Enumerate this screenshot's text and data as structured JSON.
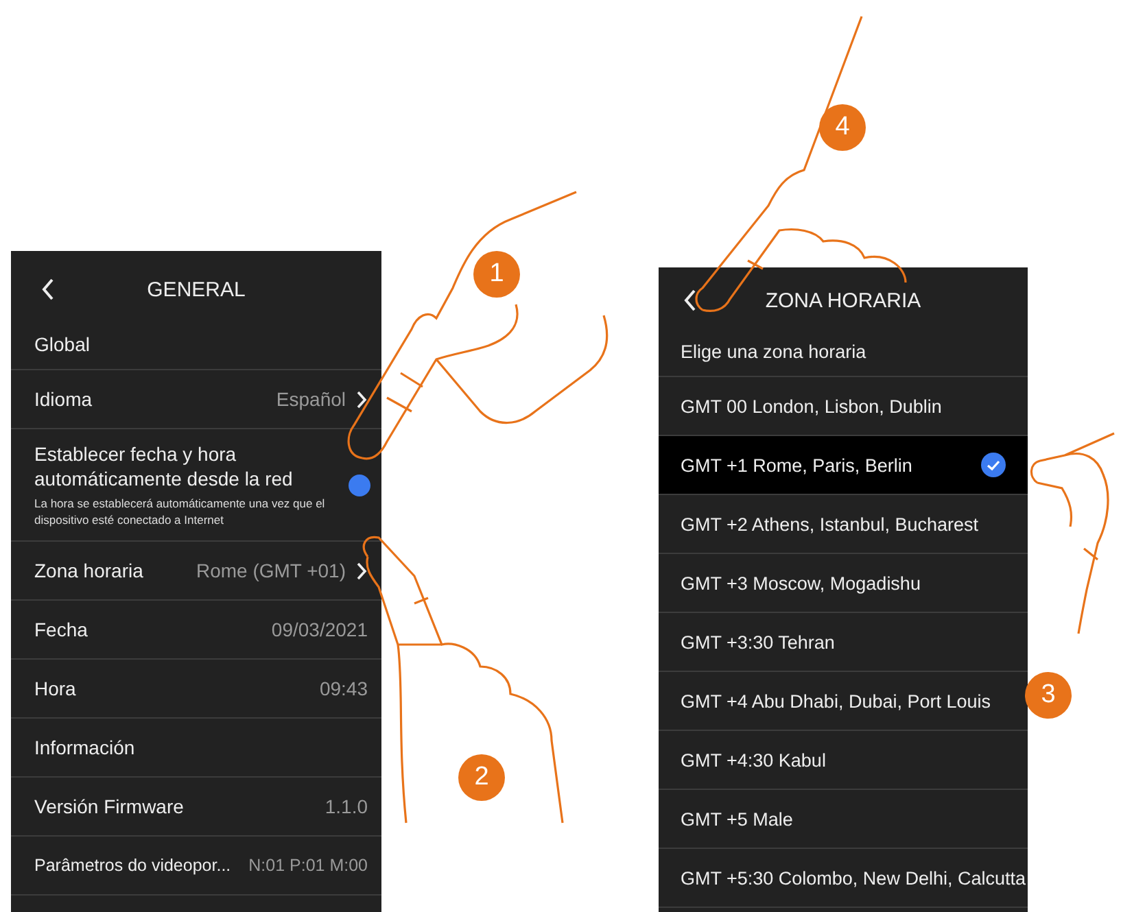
{
  "general_screen": {
    "title": "GENERAL",
    "section": "Global",
    "rows": [
      {
        "kind": "link",
        "label": "Idioma",
        "value": "Español"
      },
      {
        "kind": "toggle",
        "label": "Establecer fecha y hora automáticamente desde la red",
        "description": "La hora se establecerá automáticamente una vez que el dispositivo esté conectado a Internet",
        "on": true
      },
      {
        "kind": "link",
        "label": "Zona horaria",
        "value": "Rome (GMT +01)"
      },
      {
        "kind": "info",
        "label": "Fecha",
        "value": "09/03/2021"
      },
      {
        "kind": "info",
        "label": "Hora",
        "value": "09:43"
      },
      {
        "kind": "info",
        "label": "Información"
      },
      {
        "kind": "info",
        "label": "Versión Firmware",
        "value": "1.1.0"
      },
      {
        "kind": "info",
        "label": "Parâmetros do videopor...",
        "value": "N:01 P:01 M:00"
      }
    ]
  },
  "time_zone_screen": {
    "title": "ZONA HORARIA",
    "prompt": "Elige una zona horaria",
    "zones": [
      {
        "label": "GMT 00 London, Lisbon, Dublin",
        "selected": false
      },
      {
        "label": "GMT +1 Rome, Paris, Berlin",
        "selected": true
      },
      {
        "label": "GMT +2 Athens, Istanbul, Bucharest",
        "selected": false
      },
      {
        "label": "GMT +3 Moscow, Mogadishu",
        "selected": false
      },
      {
        "label": "GMT +3:30 Tehran",
        "selected": false
      },
      {
        "label": "GMT +4 Abu Dhabi, Dubai, Port Louis",
        "selected": false
      },
      {
        "label": "GMT +4:30 Kabul",
        "selected": false
      },
      {
        "label": "GMT +5 Male",
        "selected": false
      },
      {
        "label": "GMT +5:30 Colombo, New Delhi, Calcutta",
        "selected": false
      }
    ]
  },
  "callouts": [
    "1",
    "2",
    "3",
    "4"
  ]
}
